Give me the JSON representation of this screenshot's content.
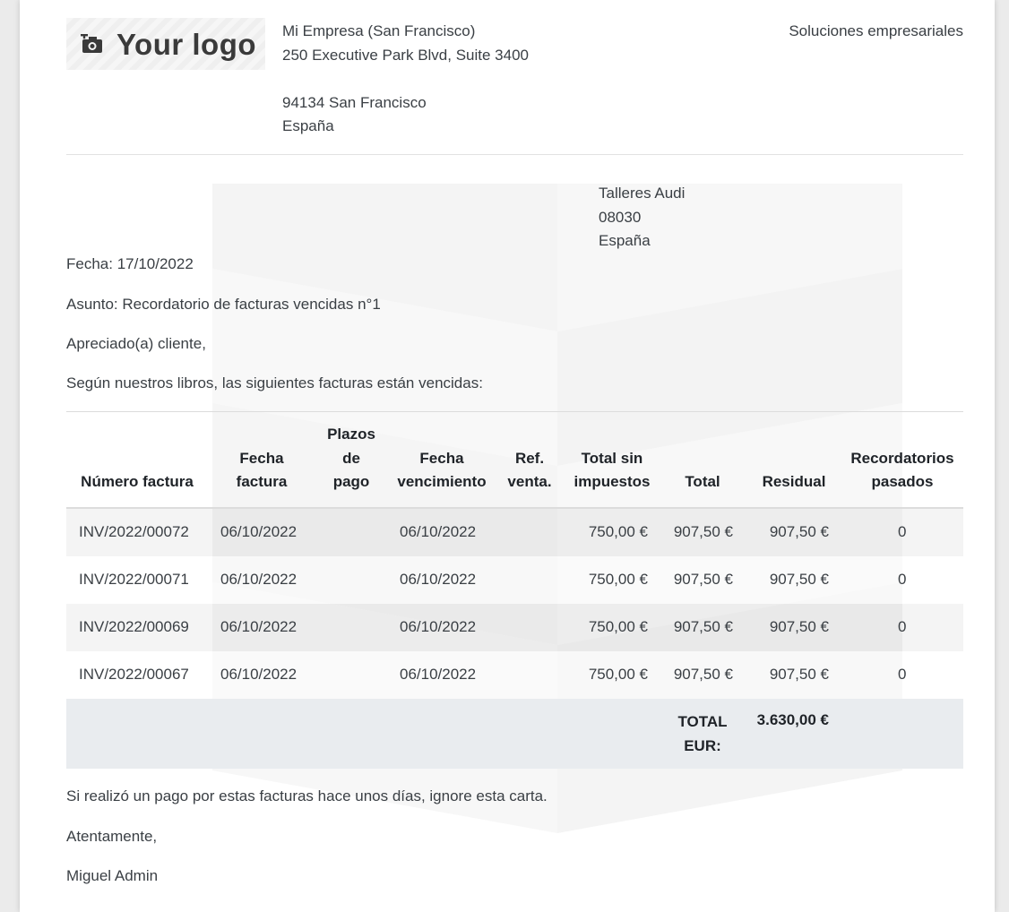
{
  "header": {
    "logo_text": "Your logo",
    "company": {
      "name": "Mi Empresa (San Francisco)",
      "street": "250 Executive Park Blvd, Suite 3400",
      "zip_city": "94134 San Francisco",
      "country": "España"
    },
    "tagline": "Soluciones empresariales"
  },
  "partner": {
    "name": "Talleres Audi",
    "zip": "08030",
    "country": "España"
  },
  "letter": {
    "date": "Fecha: 17/10/2022",
    "subject": "Asunto: Recordatorio de facturas vencidas n°1",
    "greeting": "Apreciado(a) cliente,",
    "intro": "Según nuestros libros, las siguientes facturas están vencidas:",
    "closing_note": "Si realizó un pago por estas facturas hace unos días, ignore esta carta.",
    "regards": "Atentamente,",
    "signature": "Miguel Admin"
  },
  "table": {
    "headers": {
      "invoice_number": "Número factura",
      "invoice_date": [
        "Fecha",
        "factura"
      ],
      "payment_terms": [
        "Plazos",
        "de",
        "pago"
      ],
      "due_date": [
        "Fecha",
        "vencimiento"
      ],
      "sale_ref": [
        "Ref.",
        "venta."
      ],
      "untaxed": [
        "Total sin",
        "impuestos"
      ],
      "total": "Total",
      "residual": "Residual",
      "reminders": [
        "Recordatorios",
        "pasados"
      ]
    },
    "rows": [
      {
        "number": "INV/2022/00072",
        "date": "06/10/2022",
        "terms": "",
        "due": "06/10/2022",
        "ref": "",
        "untaxed": "750,00 €",
        "total": "907,50 €",
        "residual": "907,50 €",
        "reminders": "0"
      },
      {
        "number": "INV/2022/00071",
        "date": "06/10/2022",
        "terms": "",
        "due": "06/10/2022",
        "ref": "",
        "untaxed": "750,00 €",
        "total": "907,50 €",
        "residual": "907,50 €",
        "reminders": "0"
      },
      {
        "number": "INV/2022/00069",
        "date": "06/10/2022",
        "terms": "",
        "due": "06/10/2022",
        "ref": "",
        "untaxed": "750,00 €",
        "total": "907,50 €",
        "residual": "907,50 €",
        "reminders": "0"
      },
      {
        "number": "INV/2022/00067",
        "date": "06/10/2022",
        "terms": "",
        "due": "06/10/2022",
        "ref": "",
        "untaxed": "750,00 €",
        "total": "907,50 €",
        "residual": "907,50 €",
        "reminders": "0"
      }
    ],
    "total_label": [
      "TOTAL",
      "EUR:"
    ],
    "total_value": "3.630,00 €"
  }
}
